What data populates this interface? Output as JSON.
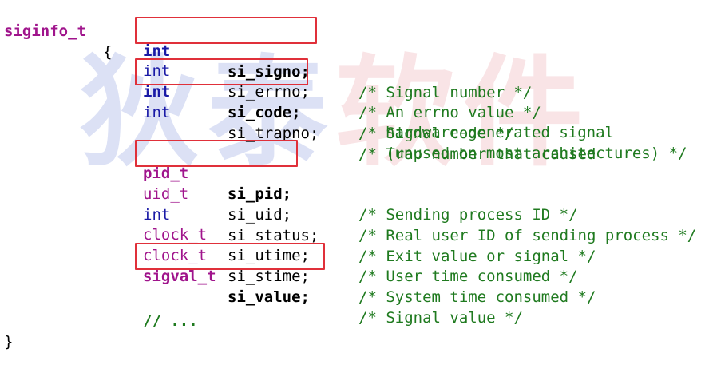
{
  "watermark": [
    "狄",
    "泰",
    "软",
    "件"
  ],
  "header": {
    "struct_name": "siginfo_t",
    "open_brace": "{"
  },
  "fields": [
    {
      "type": "int",
      "name": "si_signo;",
      "comment": "/* Signal number */",
      "type_kind": "keyword",
      "highlighted": true
    },
    {
      "type": "int",
      "name": "si_errno;",
      "comment": "/* An errno value */",
      "type_kind": "keyword",
      "highlighted": false
    },
    {
      "type": "int",
      "name": "si_code;",
      "comment": "/* Signal code */",
      "type_kind": "keyword",
      "highlighted": true
    },
    {
      "type": "int",
      "name": "si_trapno;",
      "comment": "/* Trap number that caused",
      "type_kind": "keyword",
      "highlighted": false,
      "comment_continued": [
        "hardware-generated signal",
        "(unused on most architectures) */"
      ]
    },
    {
      "type": "pid_t",
      "name": "si_pid;",
      "comment": "/* Sending process ID */",
      "type_kind": "typedef",
      "highlighted": true
    },
    {
      "type": "uid_t",
      "name": "si_uid;",
      "comment": "/* Real user ID of sending process */",
      "type_kind": "typedef",
      "highlighted": false
    },
    {
      "type": "int",
      "name": "si_status;",
      "comment": "/* Exit value or signal */",
      "type_kind": "keyword",
      "highlighted": false
    },
    {
      "type": "clock_t",
      "name": "si_utime;",
      "comment": "/* User time consumed */",
      "type_kind": "typedef",
      "highlighted": false
    },
    {
      "type": "clock_t",
      "name": "si_stime;",
      "comment": "/* System time consumed */",
      "type_kind": "typedef",
      "highlighted": false
    },
    {
      "type": "sigval_t",
      "name": "si_value;",
      "comment": "/* Signal value */",
      "type_kind": "typedef",
      "highlighted": true
    }
  ],
  "ellipsis_comment": "// ...",
  "close_brace": "}",
  "colors": {
    "keyword": "#1a1aa6",
    "typedef": "#a0148c",
    "comment": "#1f7a1f",
    "highlight_border": "#e0303a"
  }
}
